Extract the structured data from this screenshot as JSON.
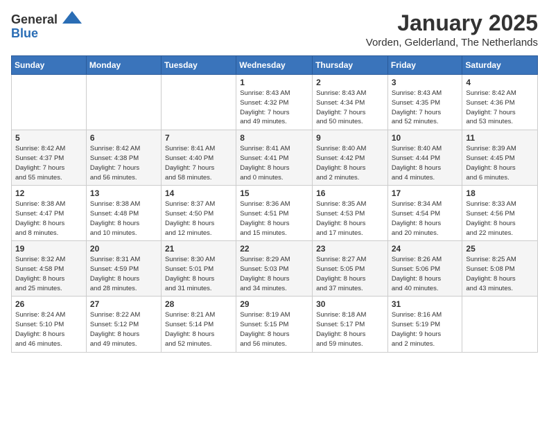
{
  "header": {
    "logo_general": "General",
    "logo_blue": "Blue",
    "title": "January 2025",
    "location": "Vorden, Gelderland, The Netherlands"
  },
  "days_of_week": [
    "Sunday",
    "Monday",
    "Tuesday",
    "Wednesday",
    "Thursday",
    "Friday",
    "Saturday"
  ],
  "weeks": [
    [
      {
        "day": "",
        "info": ""
      },
      {
        "day": "",
        "info": ""
      },
      {
        "day": "",
        "info": ""
      },
      {
        "day": "1",
        "info": "Sunrise: 8:43 AM\nSunset: 4:32 PM\nDaylight: 7 hours\nand 49 minutes."
      },
      {
        "day": "2",
        "info": "Sunrise: 8:43 AM\nSunset: 4:34 PM\nDaylight: 7 hours\nand 50 minutes."
      },
      {
        "day": "3",
        "info": "Sunrise: 8:43 AM\nSunset: 4:35 PM\nDaylight: 7 hours\nand 52 minutes."
      },
      {
        "day": "4",
        "info": "Sunrise: 8:42 AM\nSunset: 4:36 PM\nDaylight: 7 hours\nand 53 minutes."
      }
    ],
    [
      {
        "day": "5",
        "info": "Sunrise: 8:42 AM\nSunset: 4:37 PM\nDaylight: 7 hours\nand 55 minutes."
      },
      {
        "day": "6",
        "info": "Sunrise: 8:42 AM\nSunset: 4:38 PM\nDaylight: 7 hours\nand 56 minutes."
      },
      {
        "day": "7",
        "info": "Sunrise: 8:41 AM\nSunset: 4:40 PM\nDaylight: 7 hours\nand 58 minutes."
      },
      {
        "day": "8",
        "info": "Sunrise: 8:41 AM\nSunset: 4:41 PM\nDaylight: 8 hours\nand 0 minutes."
      },
      {
        "day": "9",
        "info": "Sunrise: 8:40 AM\nSunset: 4:42 PM\nDaylight: 8 hours\nand 2 minutes."
      },
      {
        "day": "10",
        "info": "Sunrise: 8:40 AM\nSunset: 4:44 PM\nDaylight: 8 hours\nand 4 minutes."
      },
      {
        "day": "11",
        "info": "Sunrise: 8:39 AM\nSunset: 4:45 PM\nDaylight: 8 hours\nand 6 minutes."
      }
    ],
    [
      {
        "day": "12",
        "info": "Sunrise: 8:38 AM\nSunset: 4:47 PM\nDaylight: 8 hours\nand 8 minutes."
      },
      {
        "day": "13",
        "info": "Sunrise: 8:38 AM\nSunset: 4:48 PM\nDaylight: 8 hours\nand 10 minutes."
      },
      {
        "day": "14",
        "info": "Sunrise: 8:37 AM\nSunset: 4:50 PM\nDaylight: 8 hours\nand 12 minutes."
      },
      {
        "day": "15",
        "info": "Sunrise: 8:36 AM\nSunset: 4:51 PM\nDaylight: 8 hours\nand 15 minutes."
      },
      {
        "day": "16",
        "info": "Sunrise: 8:35 AM\nSunset: 4:53 PM\nDaylight: 8 hours\nand 17 minutes."
      },
      {
        "day": "17",
        "info": "Sunrise: 8:34 AM\nSunset: 4:54 PM\nDaylight: 8 hours\nand 20 minutes."
      },
      {
        "day": "18",
        "info": "Sunrise: 8:33 AM\nSunset: 4:56 PM\nDaylight: 8 hours\nand 22 minutes."
      }
    ],
    [
      {
        "day": "19",
        "info": "Sunrise: 8:32 AM\nSunset: 4:58 PM\nDaylight: 8 hours\nand 25 minutes."
      },
      {
        "day": "20",
        "info": "Sunrise: 8:31 AM\nSunset: 4:59 PM\nDaylight: 8 hours\nand 28 minutes."
      },
      {
        "day": "21",
        "info": "Sunrise: 8:30 AM\nSunset: 5:01 PM\nDaylight: 8 hours\nand 31 minutes."
      },
      {
        "day": "22",
        "info": "Sunrise: 8:29 AM\nSunset: 5:03 PM\nDaylight: 8 hours\nand 34 minutes."
      },
      {
        "day": "23",
        "info": "Sunrise: 8:27 AM\nSunset: 5:05 PM\nDaylight: 8 hours\nand 37 minutes."
      },
      {
        "day": "24",
        "info": "Sunrise: 8:26 AM\nSunset: 5:06 PM\nDaylight: 8 hours\nand 40 minutes."
      },
      {
        "day": "25",
        "info": "Sunrise: 8:25 AM\nSunset: 5:08 PM\nDaylight: 8 hours\nand 43 minutes."
      }
    ],
    [
      {
        "day": "26",
        "info": "Sunrise: 8:24 AM\nSunset: 5:10 PM\nDaylight: 8 hours\nand 46 minutes."
      },
      {
        "day": "27",
        "info": "Sunrise: 8:22 AM\nSunset: 5:12 PM\nDaylight: 8 hours\nand 49 minutes."
      },
      {
        "day": "28",
        "info": "Sunrise: 8:21 AM\nSunset: 5:14 PM\nDaylight: 8 hours\nand 52 minutes."
      },
      {
        "day": "29",
        "info": "Sunrise: 8:19 AM\nSunset: 5:15 PM\nDaylight: 8 hours\nand 56 minutes."
      },
      {
        "day": "30",
        "info": "Sunrise: 8:18 AM\nSunset: 5:17 PM\nDaylight: 8 hours\nand 59 minutes."
      },
      {
        "day": "31",
        "info": "Sunrise: 8:16 AM\nSunset: 5:19 PM\nDaylight: 9 hours\nand 2 minutes."
      },
      {
        "day": "",
        "info": ""
      }
    ]
  ]
}
